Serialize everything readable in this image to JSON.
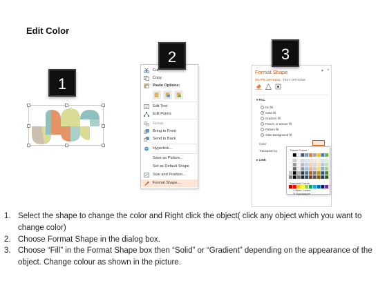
{
  "title": "Edit Color",
  "badges": [
    "1",
    "2",
    "3"
  ],
  "context_menu": {
    "items": [
      {
        "label": "Cut",
        "icon": "scissors-icon"
      },
      {
        "label": "Copy",
        "icon": "copy-icon"
      },
      {
        "label": "Paste Options:",
        "icon": "paste-icon"
      },
      {
        "label": "Edit Text",
        "icon": "edit-text-icon"
      },
      {
        "label": "Edit Points",
        "icon": "edit-points-icon"
      },
      {
        "label": "Group",
        "icon": "group-icon"
      },
      {
        "label": "Bring to Front",
        "icon": "bring-front-icon"
      },
      {
        "label": "Send to Back",
        "icon": "send-back-icon"
      },
      {
        "label": "Hyperlink...",
        "icon": "hyperlink-icon"
      },
      {
        "label": "Save as Picture...",
        "icon": ""
      },
      {
        "label": "Set as Default Shape",
        "icon": ""
      },
      {
        "label": "Size and Position...",
        "icon": "size-position-icon"
      },
      {
        "label": "Format Shape...",
        "icon": "format-shape-icon"
      }
    ]
  },
  "format_panel": {
    "title": "Format Shape",
    "tab_shape": "SHAPE OPTIONS",
    "tab_text": "TEXT OPTIONS",
    "fill_section": "FILL",
    "fill_options": [
      "No fill",
      "Solid fill",
      "Gradient fill",
      "Picture or texture fill",
      "Pattern fill",
      "Slide background fill"
    ],
    "selected_fill": "Solid fill",
    "color_label": "Color",
    "transparency_label": "Transparency",
    "line_section": "LINE"
  },
  "color_popup": {
    "theme_label": "Theme Colors",
    "standard_label": "Standard Colors",
    "more_colors": "More Colors...",
    "eyedropper": "Eyedropper",
    "theme_colors": [
      "#ffffff",
      "#000000",
      "#e7e6e6",
      "#44546a",
      "#5b9bd5",
      "#ed7d31",
      "#a5a5a5",
      "#ffc000",
      "#4472c4",
      "#70ad47"
    ],
    "standard_colors": [
      "#c00000",
      "#ff0000",
      "#ffc000",
      "#ffff00",
      "#92d050",
      "#00b050",
      "#00b0f0",
      "#0070c0",
      "#002060",
      "#7030a0"
    ]
  },
  "shape_colors": [
    "#cdbfb0",
    "#e5946a",
    "#8ec1bd",
    "#d8dc95",
    "#a9cfc9"
  ],
  "steps": [
    {
      "num": "1.",
      "text": "Select the shape to change the color and Right click the object( click any object which you want to change color)"
    },
    {
      "num": "2.",
      "text": "Choose Format Shape in the dialog box."
    },
    {
      "num": "3.",
      "text": "Choose “Fill” in the Format Shape box then “Solid” or “Gradient” depending on the appearance of the object. Change colour as shown in the picture."
    }
  ]
}
